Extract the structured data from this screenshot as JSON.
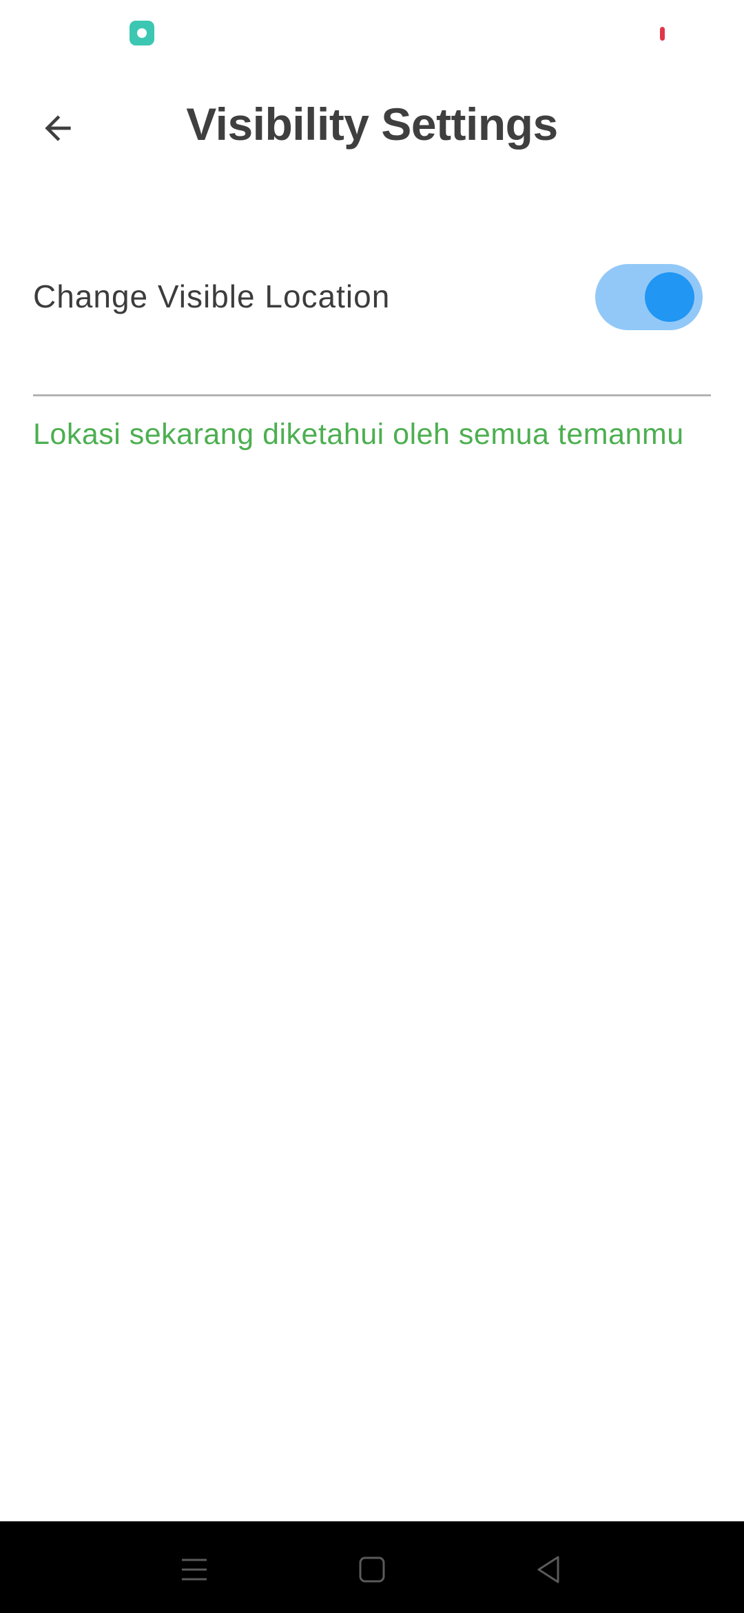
{
  "status_bar": {
    "app_icon": "screen-recorder-icon",
    "indicator_color": "#e0364a"
  },
  "app_bar": {
    "back_icon": "arrow-left-icon",
    "title": "Visibility Settings"
  },
  "setting": {
    "label": "Change Visible Location",
    "toggle_on": true,
    "toggle_track_color": "#92c8f8",
    "toggle_knob_color": "#2196f3"
  },
  "status_message": {
    "text": "Lokasi sekarang diketahui oleh semua temanmu",
    "color": "#4caf50"
  },
  "nav_bar": {
    "buttons": [
      "menu-icon",
      "home-icon",
      "back-triangle-icon"
    ]
  }
}
